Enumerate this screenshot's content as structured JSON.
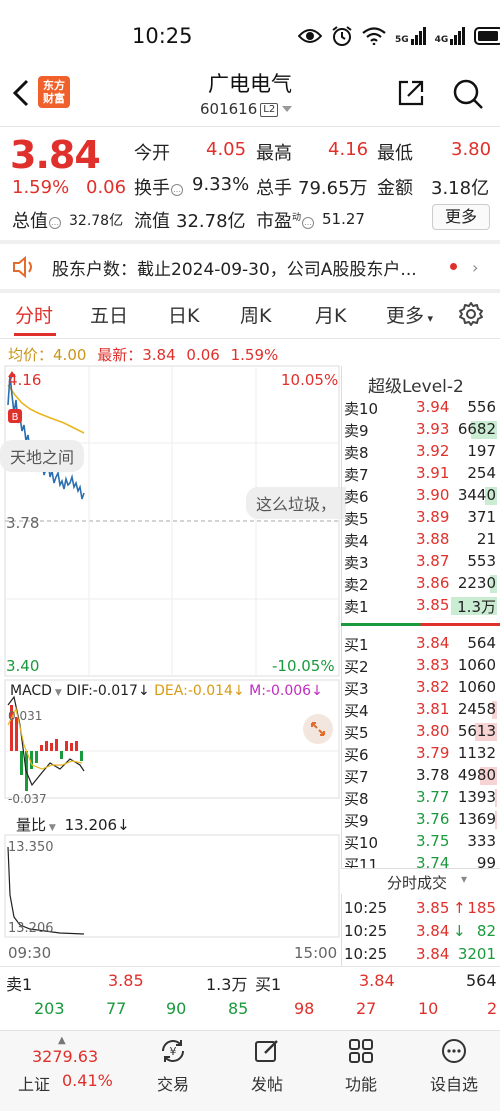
{
  "status": {
    "time": "10:25",
    "signal_5g": "5G",
    "signal_4g": "4G"
  },
  "header": {
    "logo_top": "东方",
    "logo_bottom": "财富",
    "name": "广电电气",
    "code": "601616",
    "level_badge": "L2"
  },
  "quote": {
    "price": "3.84",
    "pct": "1.59%",
    "change": "0.06",
    "open_label": "今开",
    "open": "4.05",
    "high_label": "最高",
    "high": "4.16",
    "low_label": "最低",
    "low": "3.80",
    "turnover_label": "换手",
    "turnover": "9.33%",
    "volume_label": "总手",
    "volume": "79.65万",
    "amount_label": "金额",
    "amount": "3.18亿",
    "mcap_label": "总值",
    "mcap": "32.78亿",
    "float_label": "流值",
    "float": "32.78亿",
    "pe_label": "市盈",
    "pe_sup": "动",
    "pe": "51.27",
    "more": "更多"
  },
  "notice": {
    "text": "股东户数：截止2024-09-30，公司A股股东户..."
  },
  "tabs": [
    "分时",
    "五日",
    "日K",
    "周K",
    "月K",
    "更多"
  ],
  "chart": {
    "avg_label": "均价：",
    "avg": "4.00",
    "latest_label": "最新：",
    "latest": "3.84",
    "latest_chg": "0.06",
    "latest_pct": "1.59%",
    "y_top": "4.16",
    "y_mid": "3.78",
    "y_bottom": "3.40",
    "pct_top": "10.05%",
    "pct_bottom": "-10.05%",
    "bubble1": "天地之间",
    "bubble2": "这么垃圾，",
    "marker_b": "B",
    "macd_label": "MACD",
    "dif": "DIF:-0.017",
    "dea": "DEA:-0.014",
    "m": "M:-0.006",
    "macd_top": "0.031",
    "macd_bottom": "-0.037",
    "vr_label": "量比",
    "vr_value": "13.206",
    "vr_top": "13.350",
    "vr_bottom": "13.206",
    "time_start": "09:30",
    "time_end": "15:00"
  },
  "level2": {
    "title": "超级Level-2"
  },
  "sell_orders": [
    {
      "label": "卖10",
      "price": "3.94",
      "qty": "556",
      "bar": 0.0
    },
    {
      "label": "卖9",
      "price": "3.93",
      "qty": "6682",
      "bar": 0.55
    },
    {
      "label": "卖8",
      "price": "3.92",
      "qty": "197",
      "bar": 0.0
    },
    {
      "label": "卖7",
      "price": "3.91",
      "qty": "254",
      "bar": 0.0
    },
    {
      "label": "卖6",
      "price": "3.90",
      "qty": "3440",
      "bar": 0.25
    },
    {
      "label": "卖5",
      "price": "3.89",
      "qty": "371",
      "bar": 0.0
    },
    {
      "label": "卖4",
      "price": "3.88",
      "qty": "21",
      "bar": 0.0
    },
    {
      "label": "卖3",
      "price": "3.87",
      "qty": "553",
      "bar": 0.0
    },
    {
      "label": "卖2",
      "price": "3.86",
      "qty": "2230",
      "bar": 0.15
    },
    {
      "label": "卖1",
      "price": "3.85",
      "qty": "1.3万",
      "bar": 0.95
    }
  ],
  "buy_orders": [
    {
      "label": "买1",
      "price": "3.84",
      "qty": "564",
      "bar": 0.0
    },
    {
      "label": "买2",
      "price": "3.83",
      "qty": "1060",
      "bar": 0.0
    },
    {
      "label": "买3",
      "price": "3.82",
      "qty": "1060",
      "bar": 0.0
    },
    {
      "label": "买4",
      "price": "3.81",
      "qty": "2458",
      "bar": 0.1
    },
    {
      "label": "买5",
      "price": "3.80",
      "qty": "5613",
      "bar": 0.45
    },
    {
      "label": "买6",
      "price": "3.79",
      "qty": "1132",
      "bar": 0.0
    },
    {
      "label": "买7",
      "price": "3.78",
      "qty": "4980",
      "bar": 0.35
    },
    {
      "label": "买8",
      "price": "3.77",
      "qty": "1393",
      "bar": 0.05
    },
    {
      "label": "买9",
      "price": "3.76",
      "qty": "1369",
      "bar": 0.05
    },
    {
      "label": "买10",
      "price": "3.75",
      "qty": "333",
      "bar": 0.0
    },
    {
      "label": "买11",
      "price": "3.74",
      "qty": "99",
      "bar": 0.0
    }
  ],
  "trades": {
    "title": "分时成交",
    "rows": [
      {
        "time": "10:25",
        "price": "3.85",
        "arrow": "↑",
        "qty": "185",
        "dir": "up"
      },
      {
        "time": "10:25",
        "price": "3.84",
        "arrow": "↓",
        "qty": "82",
        "dir": "down"
      },
      {
        "time": "10:25",
        "price": "3.84",
        "arrow": "",
        "qty": "3201",
        "dir": "neutral"
      }
    ]
  },
  "best_row": {
    "sell_label": "卖1",
    "sell_price": "3.85",
    "sell_qty": "1.3万",
    "buy_label": "买1",
    "buy_price": "3.84",
    "buy_qty": "564"
  },
  "counts": [
    "203",
    "77",
    "90",
    "85",
    "98",
    "27",
    "10",
    "2"
  ],
  "index": {
    "value": "3279.63",
    "name": "上证",
    "pct": "0.41%"
  },
  "nav": [
    "交易",
    "发帖",
    "功能",
    "设自选"
  ],
  "colors": {
    "red": "#e0302b",
    "green": "#1a9a3c",
    "avg_line": "#e9b51f",
    "price_line": "#2c6fb0"
  }
}
